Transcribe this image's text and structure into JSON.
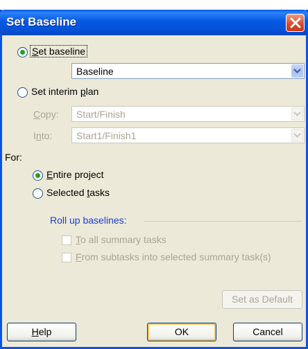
{
  "window": {
    "title": "Set Baseline"
  },
  "options": {
    "set_baseline": {
      "prefix": "S",
      "rest": "et baseline",
      "checked": true
    },
    "baseline_select": {
      "value": "Baseline"
    },
    "set_interim": {
      "prefix": "Set interim ",
      "underline": "p",
      "rest": "lan",
      "checked": false
    },
    "copy": {
      "label_u": "C",
      "label_rest": "opy:",
      "value": "Start/Finish"
    },
    "into": {
      "label_pre": "I",
      "label_u": "n",
      "label_rest": "to:",
      "value": "Start1/Finish1"
    }
  },
  "for_section": {
    "label": "For:",
    "entire": {
      "u": "E",
      "rest": "ntire project",
      "checked": true
    },
    "selected": {
      "pre": "Selected ",
      "u": "t",
      "rest": "asks",
      "checked": false
    }
  },
  "rollup": {
    "heading": "Roll up baselines:",
    "to_all": {
      "u": "T",
      "rest": "o all summary tasks",
      "checked": false
    },
    "from_sub": {
      "u": "F",
      "rest": "rom subtasks into selected summary task(s)",
      "checked": false
    }
  },
  "buttons": {
    "set_default": "Set as Default",
    "help_u": "H",
    "help_rest": "elp",
    "ok": "OK",
    "cancel": "Cancel"
  },
  "colors": {
    "title_bar": "#0a55e0",
    "dialog_bg": "#ece9d8",
    "accent_heading": "#1a3fd1"
  }
}
